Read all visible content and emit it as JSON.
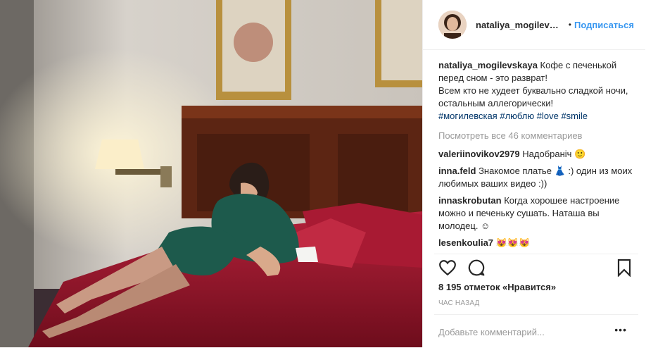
{
  "post": {
    "username": "nataliya_mogilevsk...",
    "dot": "•",
    "follow_label": "Подписаться",
    "caption": {
      "username": "nataliya_mogilevskaya",
      "text": "Кофе с печенькой перед сном - это разврат!\nВсем кто не худеет буквально сладкой ночи, остальным аллегорически!",
      "tags": [
        "#могилевская",
        "#люблю",
        "#love",
        "#smile"
      ]
    },
    "view_all_label": "Посмотреть все 46 комментариев",
    "comments": [
      {
        "username": "valeriinovikov2979",
        "text": "Надобранiч 🙂"
      },
      {
        "username": "inna.feld",
        "text": "Знакомое платье 👗 :) один из моих любимых ваших видео :))"
      },
      {
        "username": "innaskrobutan",
        "text": "Когда хорошее настроение можно и печеньку сушать. Наташа вы молодец. ☺"
      },
      {
        "username": "lesenkoulia7",
        "text": "😻😻😻"
      }
    ],
    "likes": "8 195 отметок «Нравится»",
    "time": "ЧАС НАЗАД",
    "comment_placeholder": "Добавьте комментарий...",
    "more": "•••",
    "icons": [
      "heart-icon",
      "comment-icon",
      "bookmark-icon",
      "more-icon"
    ]
  }
}
